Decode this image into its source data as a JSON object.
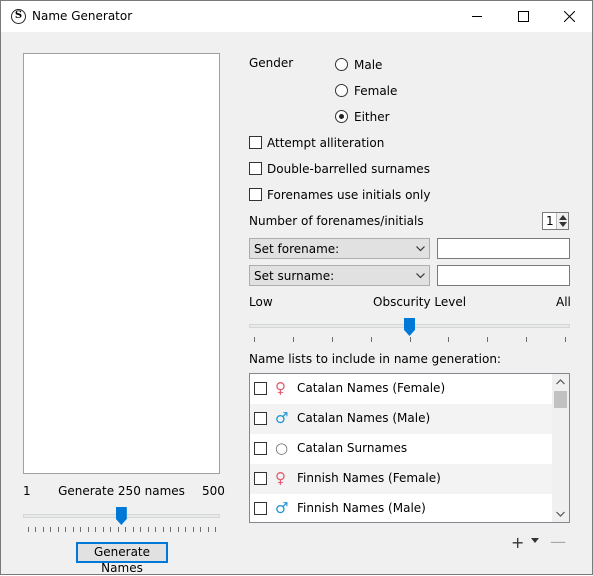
{
  "window": {
    "title": "Name Generator",
    "app_icon_glyph": "S"
  },
  "generator": {
    "min_label": "1",
    "count_label": "Generate 250 names",
    "max_label": "500",
    "slider": {
      "min": 1,
      "max": 500,
      "value": 250
    },
    "button_label": "Generate Names"
  },
  "gender": {
    "label": "Gender",
    "options": [
      "Male",
      "Female",
      "Either"
    ],
    "selected": "Either"
  },
  "options": {
    "alliteration": "Attempt alliteration",
    "double_barrelled": "Double-barrelled surnames",
    "initials_only": "Forenames use initials only"
  },
  "forenames_count": {
    "label": "Number of forenames/initials",
    "value": "1"
  },
  "set_forename": {
    "label": "Set forename:",
    "value": ""
  },
  "set_surname": {
    "label": "Set surname:",
    "value": ""
  },
  "obscurity": {
    "low_label": "Low",
    "title": "Obscurity Level",
    "high_label": "All",
    "value_fraction": 0.5
  },
  "name_lists": {
    "label": "Name lists to include in name generation:",
    "items": [
      {
        "name": "Catalan Names (Female)",
        "symbol": "♀",
        "symbol_color": "#e25c6f",
        "checked": false
      },
      {
        "name": "Catalan Names (Male)",
        "symbol": "♂",
        "symbol_color": "#2196d6",
        "checked": false
      },
      {
        "name": "Catalan Surnames",
        "symbol": "○",
        "symbol_color": "#777777",
        "checked": false
      },
      {
        "name": "Finnish Names (Female)",
        "symbol": "♀",
        "symbol_color": "#e25c6f",
        "checked": false
      },
      {
        "name": "Finnish Names (Male)",
        "symbol": "♂",
        "symbol_color": "#2196d6",
        "checked": false
      }
    ]
  },
  "toolbar": {
    "add_symbol": "+",
    "remove_symbol": "—"
  },
  "colors": {
    "accent": "#0078d7"
  }
}
